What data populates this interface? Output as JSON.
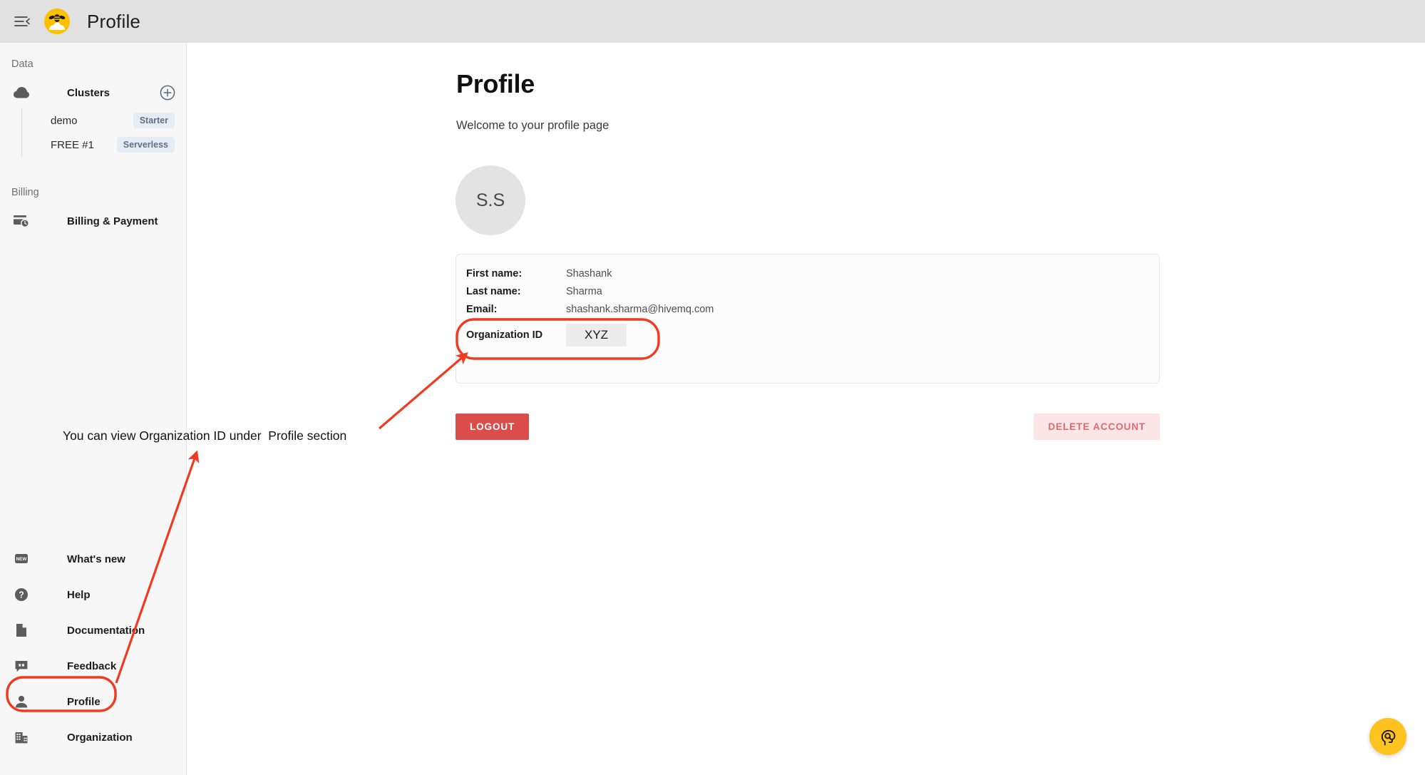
{
  "topbar": {
    "menu_icon": "menu-collapse-icon",
    "logo_icon": "hivemq-bee-logo-icon",
    "title": "Profile"
  },
  "sidebar": {
    "sections": [
      {
        "label": "Data"
      },
      {
        "label": "Billing"
      }
    ],
    "clusters_nav": {
      "icon": "cloud-icon",
      "label": "Clusters",
      "add_icon": "plus-circle-icon"
    },
    "clusters": [
      {
        "name": "demo",
        "badge": "Starter"
      },
      {
        "name": "FREE #1",
        "badge": "Serverless"
      }
    ],
    "billing_nav": {
      "icon": "credit-card-clock-icon",
      "label": "Billing & Payment"
    },
    "bottom_items": [
      {
        "icon": "new-badge-icon",
        "label": "What's new"
      },
      {
        "icon": "question-circle-icon",
        "label": "Help"
      },
      {
        "icon": "document-icon",
        "label": "Documentation"
      },
      {
        "icon": "feedback-quote-icon",
        "label": "Feedback"
      },
      {
        "icon": "person-icon",
        "label": "Profile"
      },
      {
        "icon": "building-icon",
        "label": "Organization"
      }
    ]
  },
  "main": {
    "title": "Profile",
    "subtitle": "Welcome to your profile page",
    "avatar_initials": "S.S",
    "details": [
      {
        "key": "First name:",
        "value": "Shashank"
      },
      {
        "key": "Last name:",
        "value": "Sharma"
      },
      {
        "key": "Email:",
        "value": "shashank.sharma@hivemq.com"
      }
    ],
    "org_id": {
      "key": "Organization ID",
      "value": "XYZ"
    },
    "logout_label": "LOGOUT",
    "delete_label": "DELETE ACCOUNT"
  },
  "annotation": {
    "text": "You can view Organization ID under  Profile section",
    "color": "#f03b20"
  },
  "assistant": {
    "icon": "ai-head-assistant-icon",
    "color": "#ffc31f"
  },
  "colors": {
    "topbar_bg": "#e1e1e1",
    "sidebar_bg": "#f7f7f7",
    "brand_yellow": "#ffc000",
    "badge_bg": "#e6ecf3",
    "badge_text": "#5d7187",
    "logout_bg": "#da4d4a",
    "delete_bg": "#fbe5e6",
    "delete_text": "#e06b6e",
    "annotation_red": "#f03b20"
  }
}
